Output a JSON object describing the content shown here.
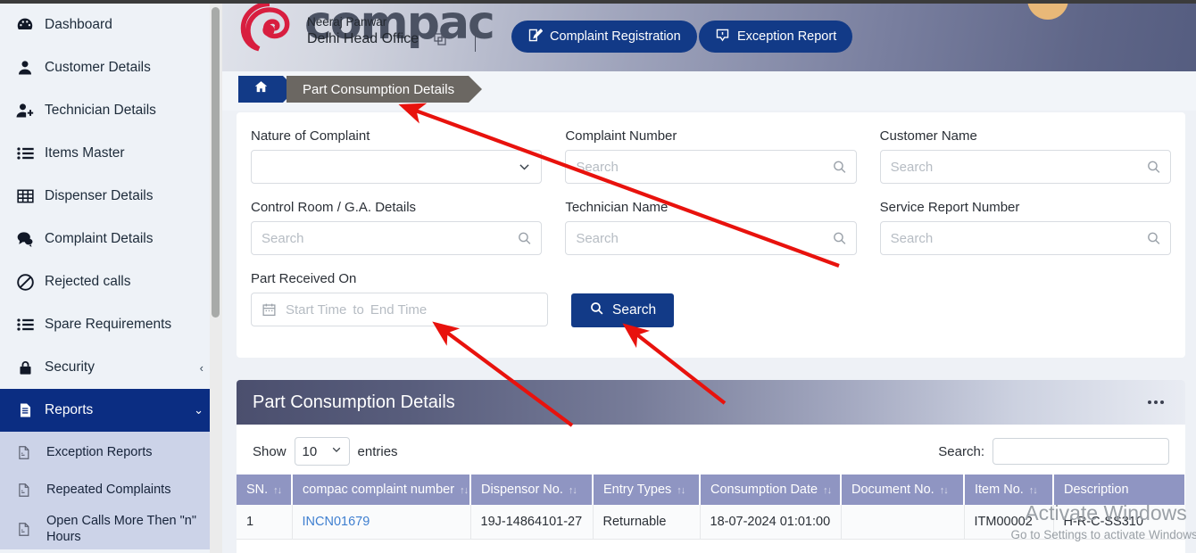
{
  "sidebar": {
    "items": [
      {
        "label": "Dashboard",
        "icon": "dashboard-icon"
      },
      {
        "label": "Customer Details",
        "icon": "user-icon"
      },
      {
        "label": "Technician Details",
        "icon": "user-plus-icon"
      },
      {
        "label": "Items Master",
        "icon": "list-icon"
      },
      {
        "label": "Dispenser Details",
        "icon": "table-grid-icon"
      },
      {
        "label": "Complaint Details",
        "icon": "chat-bubbles-icon"
      },
      {
        "label": "Rejected calls",
        "icon": "ban-icon"
      },
      {
        "label": "Spare Requirements",
        "icon": "list-icon"
      },
      {
        "label": "Security",
        "icon": "lock-icon",
        "chevron": "‹"
      },
      {
        "label": "Reports",
        "icon": "document-icon",
        "chevron": "⌄",
        "active": true
      }
    ],
    "reports_subitems": [
      {
        "label": "Exception Reports",
        "icon": "pdf-file-icon"
      },
      {
        "label": "Repeated Complaints",
        "icon": "pdf-file-icon"
      },
      {
        "label": "Open Calls More Then \"n\" Hours",
        "icon": "pdf-file-icon"
      }
    ]
  },
  "header": {
    "brand": "compac",
    "user_name": "Neeraj Panwar",
    "office": "Delhi Head Office",
    "complaint_registration_label": "Complaint Registration",
    "exception_report_label": "Exception Report"
  },
  "breadcrumb": {
    "home_icon": "home-icon",
    "current": "Part Consumption Details"
  },
  "filters": {
    "nature_of_complaint": {
      "label": "Nature of Complaint",
      "value": "",
      "type": "select"
    },
    "complaint_number": {
      "label": "Complaint Number",
      "placeholder": "Search",
      "value": ""
    },
    "customer_name": {
      "label": "Customer Name",
      "placeholder": "Search",
      "value": ""
    },
    "control_room": {
      "label": "Control Room / G.A. Details",
      "placeholder": "Search",
      "value": ""
    },
    "technician_name": {
      "label": "Technician Name",
      "placeholder": "Search",
      "value": ""
    },
    "service_report_number": {
      "label": "Service Report Number",
      "placeholder": "Search",
      "value": ""
    },
    "part_received_on": {
      "label": "Part Received On",
      "start": "Start Time",
      "to": "to",
      "end": "End Time"
    },
    "search_button": "Search"
  },
  "panel": {
    "title": "Part Consumption Details",
    "menu_icon": "ellipsis-icon",
    "show_label": "Show",
    "show_value": "10",
    "entries_label": "entries",
    "search_label": "Search:",
    "search_value": "",
    "columns": [
      "SN.",
      "compac complaint number",
      "Dispensor No.",
      "Entry Types",
      "Consumption Date",
      "Document No.",
      "Item No.",
      "Description"
    ],
    "rows": [
      {
        "sn": "1",
        "complaint_number": "INCN01679",
        "dispensor_no": "19J-14864101-27",
        "entry_type": "Returnable",
        "consumption_date": "18-07-2024 01:01:00",
        "document_no": "",
        "item_no": "ITM00002",
        "description": "H-R-C-SS310"
      }
    ],
    "sort_icon": "↑↓"
  },
  "watermark": {
    "line1": "Activate Windows",
    "line2": "Go to Settings to activate Windows."
  },
  "colors": {
    "accent_blue": "#123a87",
    "brand_red": "#d81e3f",
    "table_header": "#8f95c2",
    "annotation_red": "#e8120d"
  }
}
